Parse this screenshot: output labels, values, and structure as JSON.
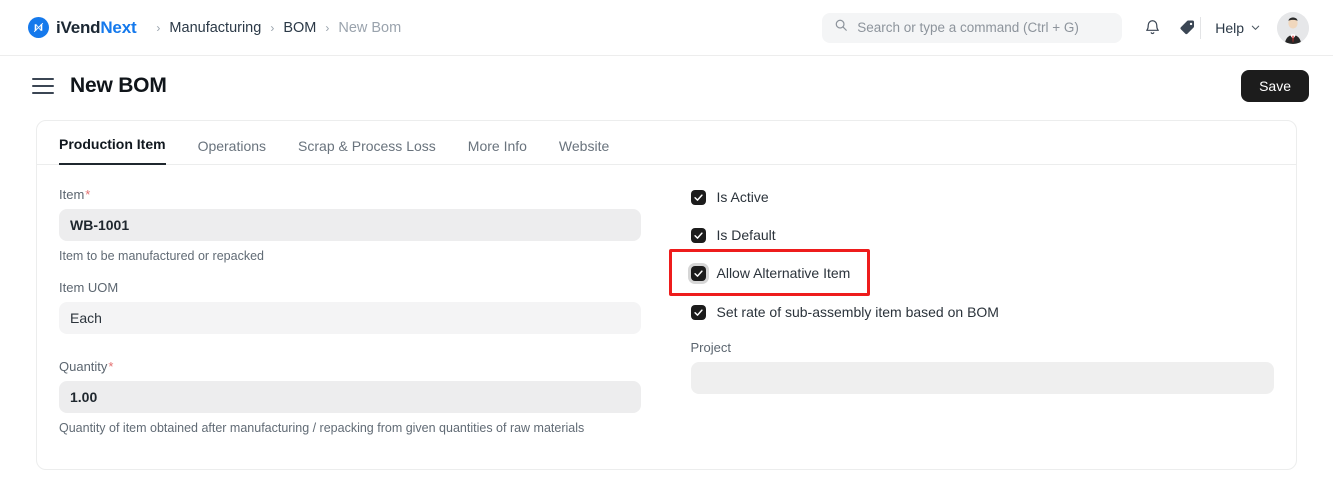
{
  "navbar": {
    "brand_primary": "iVend",
    "brand_accent": "Next",
    "breadcrumb": [
      {
        "label": "Manufacturing",
        "muted": false
      },
      {
        "label": "BOM",
        "muted": false
      },
      {
        "label": "New Bom",
        "muted": true
      }
    ],
    "breadcrumb_separator": "›",
    "search_placeholder": "Search or type a command (Ctrl + G)",
    "icons": [
      "search-icon",
      "bell-icon",
      "tag-icon"
    ],
    "help_label": "Help",
    "help_chevron": "chevron-down-icon",
    "avatar": "user-avatar"
  },
  "page": {
    "menu_icon": "hamburger-icon",
    "title": "New BOM",
    "save_label": "Save"
  },
  "tabs": [
    {
      "label": "Production Item",
      "active": true
    },
    {
      "label": "Operations",
      "active": false
    },
    {
      "label": "Scrap & Process Loss",
      "active": false
    },
    {
      "label": "More Info",
      "active": false
    },
    {
      "label": "Website",
      "active": false
    }
  ],
  "left_column": {
    "item": {
      "label": "Item",
      "required": "*",
      "value": "WB-1001",
      "hint": "Item to be manufactured or repacked"
    },
    "item_uom": {
      "label": "Item UOM",
      "value": "Each"
    },
    "quantity": {
      "label": "Quantity",
      "required": "*",
      "value": "1.00",
      "hint": "Quantity of item obtained after manufacturing / repacking from given quantities of raw materials"
    }
  },
  "right_column": {
    "checkboxes": [
      {
        "label": "Is Active",
        "checked": true,
        "highlighted": false
      },
      {
        "label": "Is Default",
        "checked": true,
        "highlighted": false
      },
      {
        "label": "Allow Alternative Item",
        "checked": true,
        "highlighted": true
      },
      {
        "label": "Set rate of sub-assembly item based on BOM",
        "checked": true,
        "highlighted": false
      }
    ],
    "project": {
      "label": "Project",
      "value": ""
    }
  },
  "colors": {
    "brand_blue": "#1579ec",
    "highlight_red": "#ee1c1c",
    "save_button_bg": "#1c1c1c",
    "input_bg": "#ededee",
    "required_asterisk": "#e47070"
  }
}
